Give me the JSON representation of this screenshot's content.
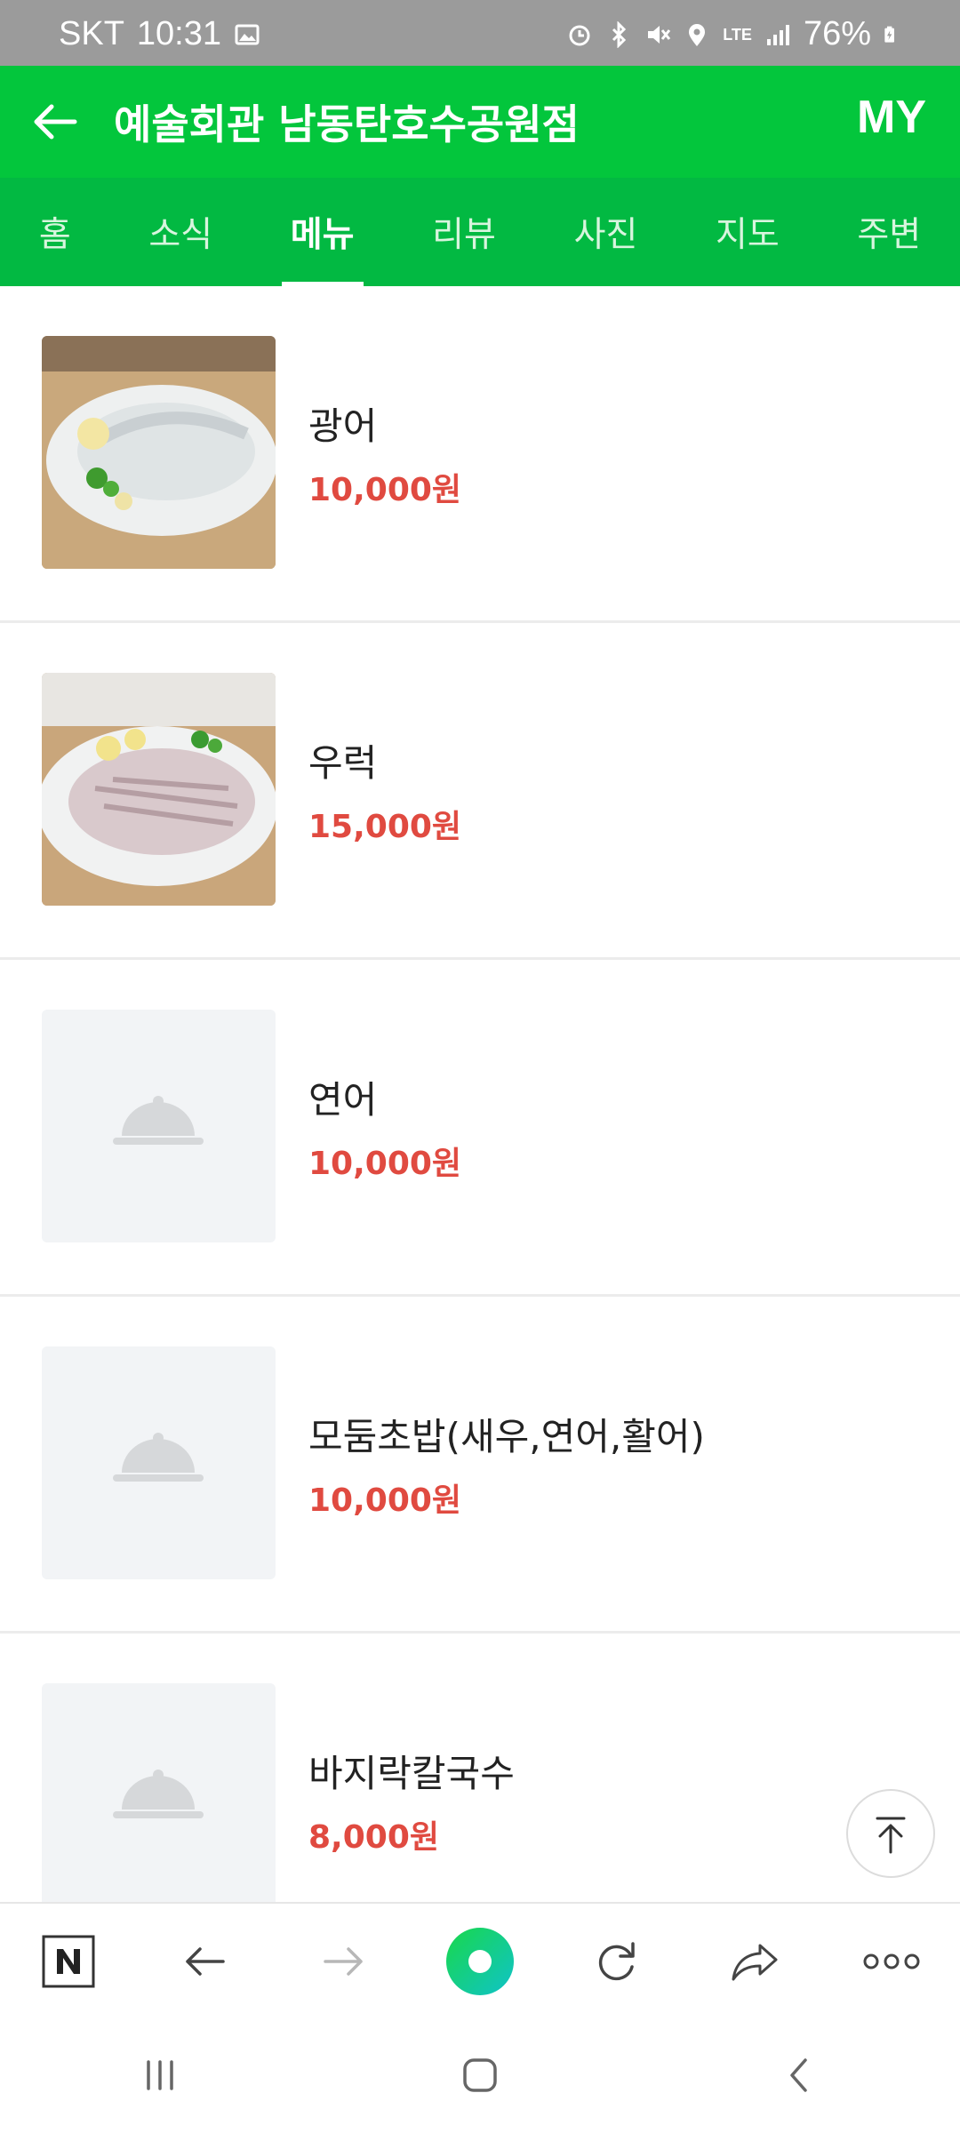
{
  "status_bar": {
    "carrier": "SKT",
    "time": "10:31",
    "battery": "76%",
    "network": "LTE",
    "icons": [
      "gallery-icon",
      "alarm-icon",
      "bluetooth-icon",
      "mute-icon",
      "location-icon",
      "lte-icon",
      "signal-icon",
      "battery-icon"
    ]
  },
  "header": {
    "title": "예술회관 남동탄호수공원점",
    "my_label": "MY",
    "color": "#03c63c"
  },
  "tabs": [
    {
      "label": "홈"
    },
    {
      "label": "소식"
    },
    {
      "label": "메뉴",
      "active": true
    },
    {
      "label": "리뷰"
    },
    {
      "label": "사진"
    },
    {
      "label": "지도"
    },
    {
      "label": "주변"
    }
  ],
  "menu": [
    {
      "name": "광어",
      "price": "10,000원",
      "image": "flatfish-sashimi-photo"
    },
    {
      "name": "우럭",
      "price": "15,000원",
      "image": "rockfish-sashimi-photo"
    },
    {
      "name": "연어",
      "price": "10,000원",
      "image": "placeholder-cloche-icon"
    },
    {
      "name": "모둠초밥(새우,연어,활어)",
      "price": "10,000원",
      "image": "placeholder-cloche-icon"
    },
    {
      "name": "바지락칼국수",
      "price": "8,000원",
      "image": "placeholder-cloche-icon"
    }
  ],
  "price_color": "#e04a40",
  "browser_toolbar": {
    "buttons": [
      "naver-home-icon",
      "back-arrow-icon",
      "forward-arrow-icon",
      "green-dot-icon",
      "refresh-icon",
      "share-icon",
      "more-dots-icon"
    ]
  },
  "system_nav": {
    "buttons": [
      "recent-apps-icon",
      "home-icon",
      "back-icon"
    ]
  }
}
